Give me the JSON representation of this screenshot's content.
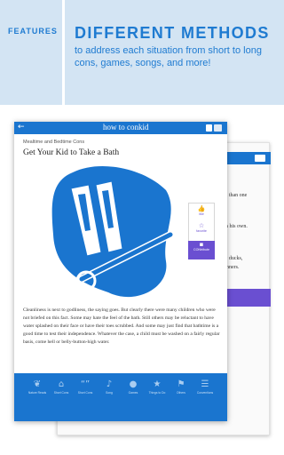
{
  "banner": {
    "tag": "FEATURES",
    "headline": "DIFFERENT METHODS",
    "subline": "to address each situation from short to long cons, games, songs, and more!"
  },
  "back_screen": {
    "lines": [
      "oel than one",
      "i",
      "run his own.",
      "nic ducks,",
      "winners."
    ]
  },
  "app": {
    "back_icon": "back-arrow-icon",
    "logo": "how to conkid",
    "category": "Mealtime and Bedtime Cons",
    "title": "Get Your Kid to Take a Bath",
    "actions": [
      {
        "icon": "thumbs-up-icon",
        "glyph": "👍",
        "label": "like"
      },
      {
        "icon": "star-icon",
        "glyph": "☆",
        "label": "favorite"
      },
      {
        "icon": "comment-icon",
        "glyph": "▪",
        "label": "CONtribute"
      }
    ],
    "body": "Cleanliness is next to godliness, the saying goes. But clearly there were many children who were not briefed on this fact. Some may hate the feel of the bath. Still others may be reluctant to have water splashed on their face or have their toes scrubbed. And some may just find that bathtime is a good time to test their independence. Whatever the case, a child must be washed on a fairly regular basis, come hell or belly-button-high water.",
    "nav": [
      {
        "icon": "bird-icon",
        "glyph": "❦",
        "label": "Nature Reads"
      },
      {
        "icon": "house-icon",
        "glyph": "⌂",
        "label": "Short Cons"
      },
      {
        "icon": "quote-icon",
        "glyph": "“”",
        "label": "Short Cons"
      },
      {
        "icon": "music-note-icon",
        "glyph": "♪",
        "label": "Song"
      },
      {
        "icon": "ball-icon",
        "glyph": "●",
        "label": "Games"
      },
      {
        "icon": "trophy-icon",
        "glyph": "★",
        "label": "Things to Do"
      },
      {
        "icon": "flag-icon",
        "glyph": "⚑",
        "label": "Others"
      },
      {
        "icon": "list-icon",
        "glyph": "☰",
        "label": "Conventions"
      }
    ]
  },
  "colors": {
    "brand_blue": "#1a75cf",
    "banner_bg": "#d3e4f3",
    "accent_purple": "#6a4fd1"
  }
}
